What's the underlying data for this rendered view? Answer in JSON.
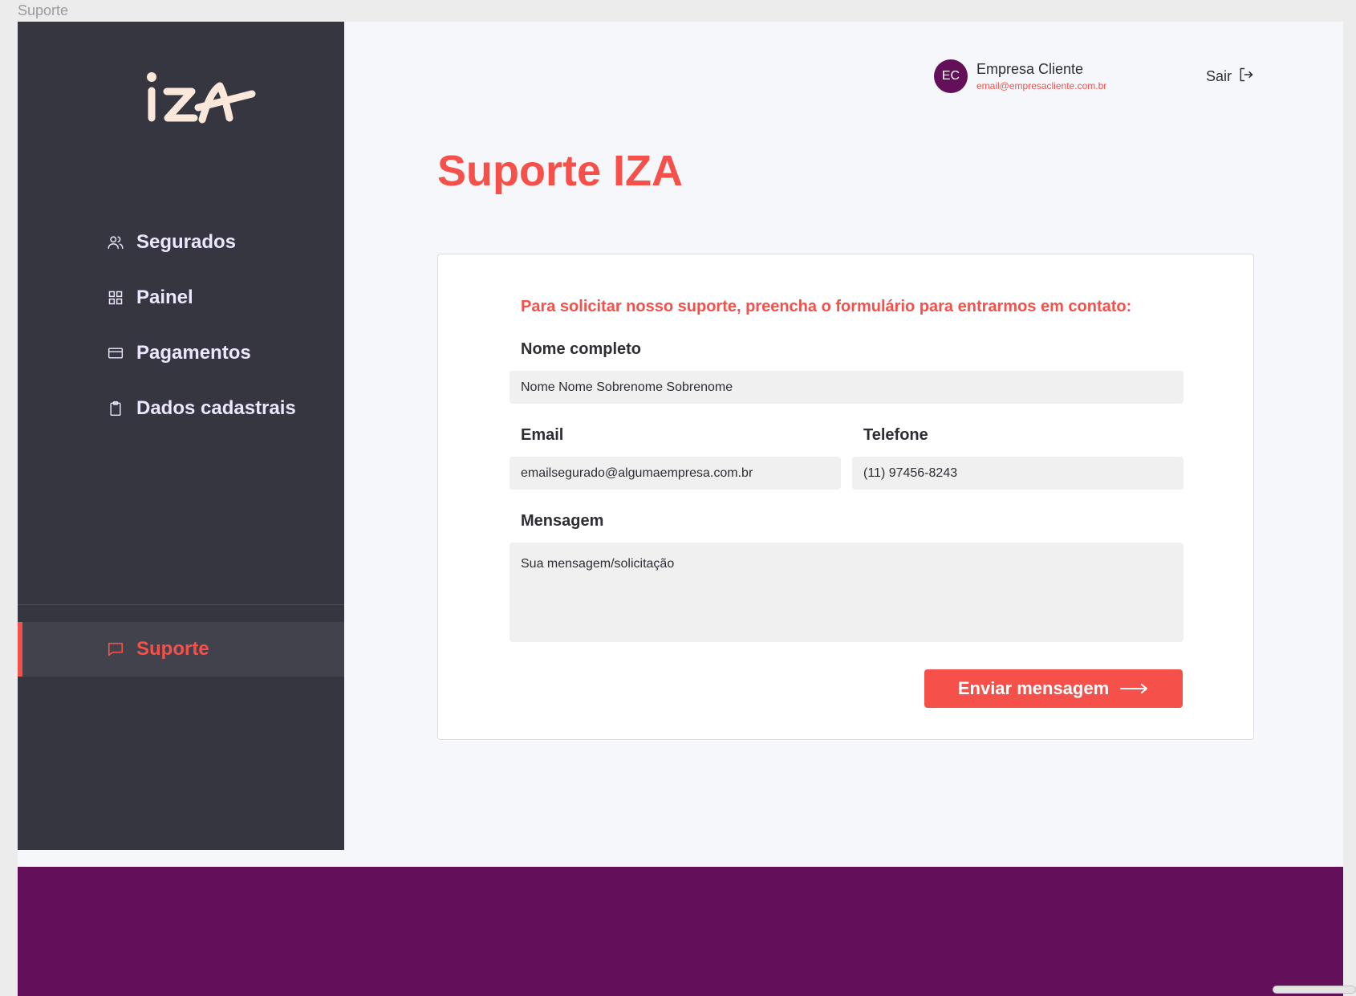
{
  "frame": {
    "label": "Suporte"
  },
  "brand": {
    "logo_text": "IZA",
    "logo_color": "#fbe8da"
  },
  "colors": {
    "accent": "#f5504a",
    "sidebar": "#363640",
    "brand_purple": "#640f5a",
    "nav_text": "#ece6ff"
  },
  "sidebar": {
    "items": [
      {
        "label": "Segurados",
        "icon": "users-icon"
      },
      {
        "label": "Painel",
        "icon": "grid-icon"
      },
      {
        "label": "Pagamentos",
        "icon": "credit-card-icon"
      },
      {
        "label": "Dados cadastrais",
        "icon": "clipboard-icon"
      }
    ],
    "active_item": {
      "label": "Suporte",
      "icon": "message-icon"
    }
  },
  "header": {
    "user": {
      "initials": "EC",
      "name": "Empresa Cliente",
      "email": "email@empresacliente.com.br"
    },
    "logout_label": "Sair"
  },
  "main": {
    "title": "Suporte IZA",
    "form": {
      "intro": "Para solicitar nosso suporte, preencha o formulário para entrarmos em contato:",
      "name_label": "Nome completo",
      "name_value": "Nome Nome Sobrenome Sobrenome",
      "email_label": "Email",
      "email_value": "emailsegurado@algumaempresa.com.br",
      "phone_label": "Telefone",
      "phone_value": "(11) 97456-8243",
      "message_label": "Mensagem",
      "message_placeholder": "Sua mensagem/solicitação",
      "submit_label": "Enviar mensagem"
    }
  }
}
